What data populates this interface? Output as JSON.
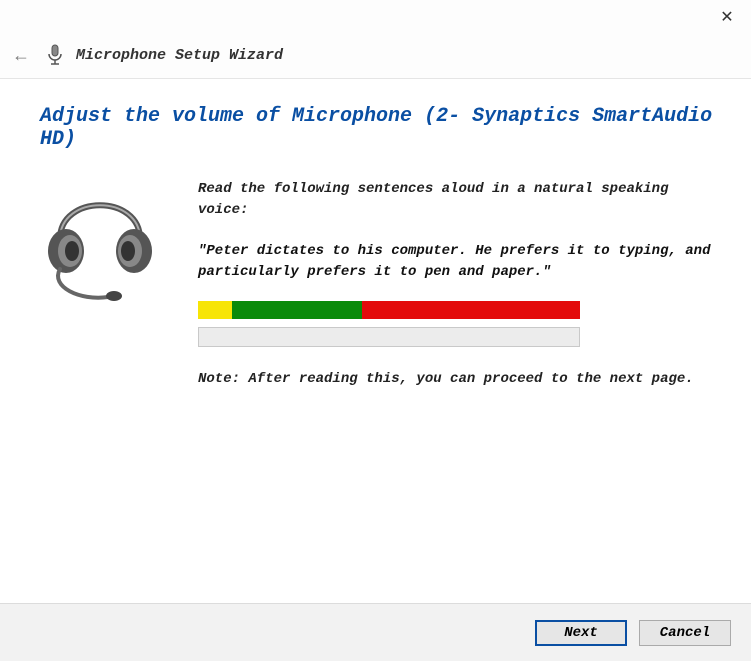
{
  "header": {
    "title": "Microphone Setup Wizard"
  },
  "page": {
    "heading": "Adjust the volume of Microphone (2- Synaptics SmartAudio HD)"
  },
  "instructions": {
    "lead": "Read the following sentences aloud in a natural speaking voice:",
    "quote": "\"Peter dictates to his computer. He prefers it to typing, and particularly prefers it to pen and paper.\"",
    "note": "Note: After reading this, you can proceed to the next page."
  },
  "meter": {
    "yellow_pct": 9,
    "green_pct": 34,
    "red_pct": 57
  },
  "buttons": {
    "next": "Next",
    "cancel": "Cancel"
  }
}
